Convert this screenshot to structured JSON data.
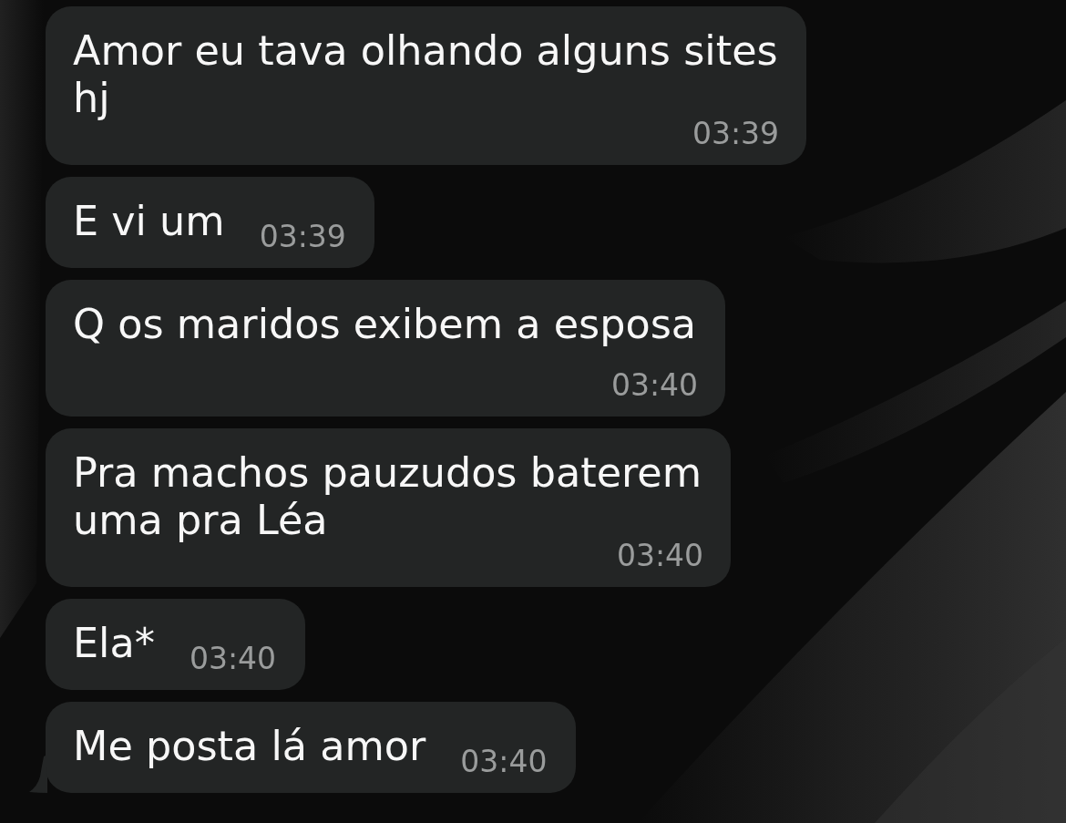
{
  "messages": [
    {
      "text": "Amor eu tava olhando alguns sites hj",
      "time": "03:39",
      "tail": false
    },
    {
      "text": "E vi um",
      "time": "03:39",
      "tail": false
    },
    {
      "text": "Q os maridos exibem a esposa",
      "time": "03:40",
      "tail": false
    },
    {
      "text": "Pra machos pauzudos baterem uma pra Léa",
      "time": "03:40",
      "tail": false
    },
    {
      "text": "Ela*",
      "time": "03:40",
      "tail": false
    },
    {
      "text": "Me posta lá amor",
      "time": "03:40",
      "tail": true
    }
  ]
}
